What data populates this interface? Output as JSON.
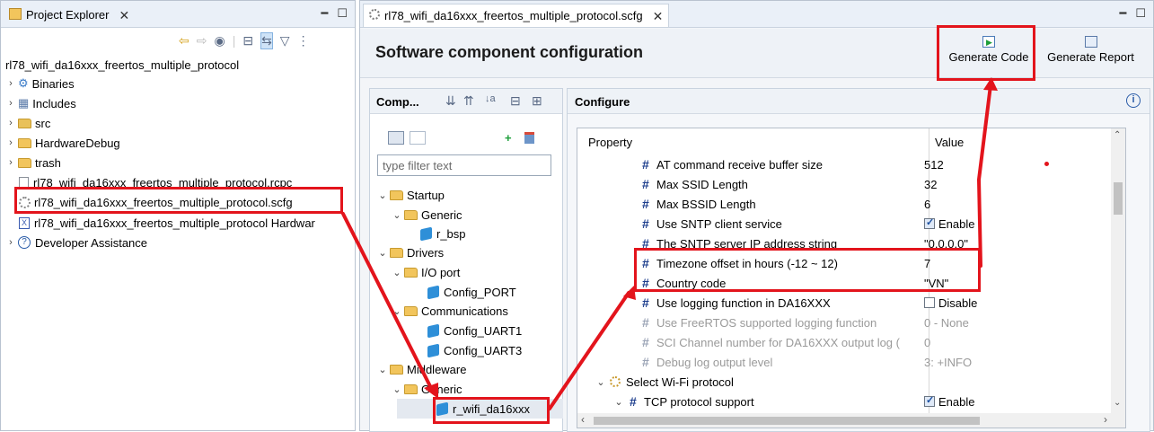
{
  "left_panel": {
    "tab_title": "Project Explorer",
    "min_icon": "minimize-icon",
    "max_icon": "maximize-icon",
    "project_name": "rl78_wifi_da16xxx_freertos_multiple_protocol",
    "tree": [
      {
        "label": "Binaries",
        "icon": "binaries-icon"
      },
      {
        "label": "Includes",
        "icon": "includes-icon"
      },
      {
        "label": "src",
        "icon": "source-folder-icon"
      },
      {
        "label": "HardwareDebug",
        "icon": "folder-icon"
      },
      {
        "label": "trash",
        "icon": "folder-icon"
      },
      {
        "label": "rl78_wifi_da16xxx_freertos_multiple_protocol.rcpc",
        "icon": "file-icon"
      },
      {
        "label": "rl78_wifi_da16xxx_freertos_multiple_protocol.scfg",
        "icon": "gear-icon"
      },
      {
        "label": "rl78_wifi_da16xxx_freertos_multiple_protocol Hardwar",
        "icon": "xml-file-icon"
      },
      {
        "label": "Developer Assistance",
        "icon": "help-icon"
      }
    ]
  },
  "editor": {
    "tab_title": "rl78_wifi_da16xxx_freertos_multiple_protocol.scfg",
    "heading": "Software component configuration",
    "generate_code": "Generate Code",
    "generate_report": "Generate Report",
    "components_title": "Comp...",
    "configure_title": "Configure",
    "filter_placeholder": "type filter text",
    "component_tree": [
      {
        "label": "Startup"
      },
      {
        "label": "Generic"
      },
      {
        "label": "r_bsp"
      },
      {
        "label": "Drivers"
      },
      {
        "label": "I/O port"
      },
      {
        "label": "Config_PORT"
      },
      {
        "label": "Communications"
      },
      {
        "label": "Config_UART1"
      },
      {
        "label": "Config_UART3"
      },
      {
        "label": "Middleware"
      },
      {
        "label": "Generic"
      },
      {
        "label": "r_wifi_da16xxx"
      }
    ],
    "table_headers": {
      "property": "Property",
      "value": "Value"
    },
    "properties": [
      {
        "name": "AT command receive buffer size",
        "value": "512"
      },
      {
        "name": "Max SSID Length",
        "value": "32"
      },
      {
        "name": "Max BSSID Length",
        "value": "6"
      },
      {
        "name": "Use SNTP client service",
        "value": "Enable"
      },
      {
        "name": "The SNTP server IP address string",
        "value": "\"0.0.0.0\""
      },
      {
        "name": "Timezone offset in hours (-12 ~ 12)",
        "value": "7"
      },
      {
        "name": "Country code",
        "value": "\"VN\""
      },
      {
        "name": "Use logging function in DA16XXX",
        "value": "Disable"
      },
      {
        "name": "Use FreeRTOS supported logging function",
        "value": "0 - None"
      },
      {
        "name": "SCI Channel number for DA16XXX output log (",
        "value": "0"
      },
      {
        "name": "Debug log output level",
        "value": "3: +INFO"
      },
      {
        "name": "Select Wi-Fi protocol",
        "value": ""
      },
      {
        "name": "TCP protocol support",
        "value": "Enable"
      }
    ]
  },
  "colors": {
    "highlight": "#e3141c",
    "accent": "#1b3c8c"
  }
}
